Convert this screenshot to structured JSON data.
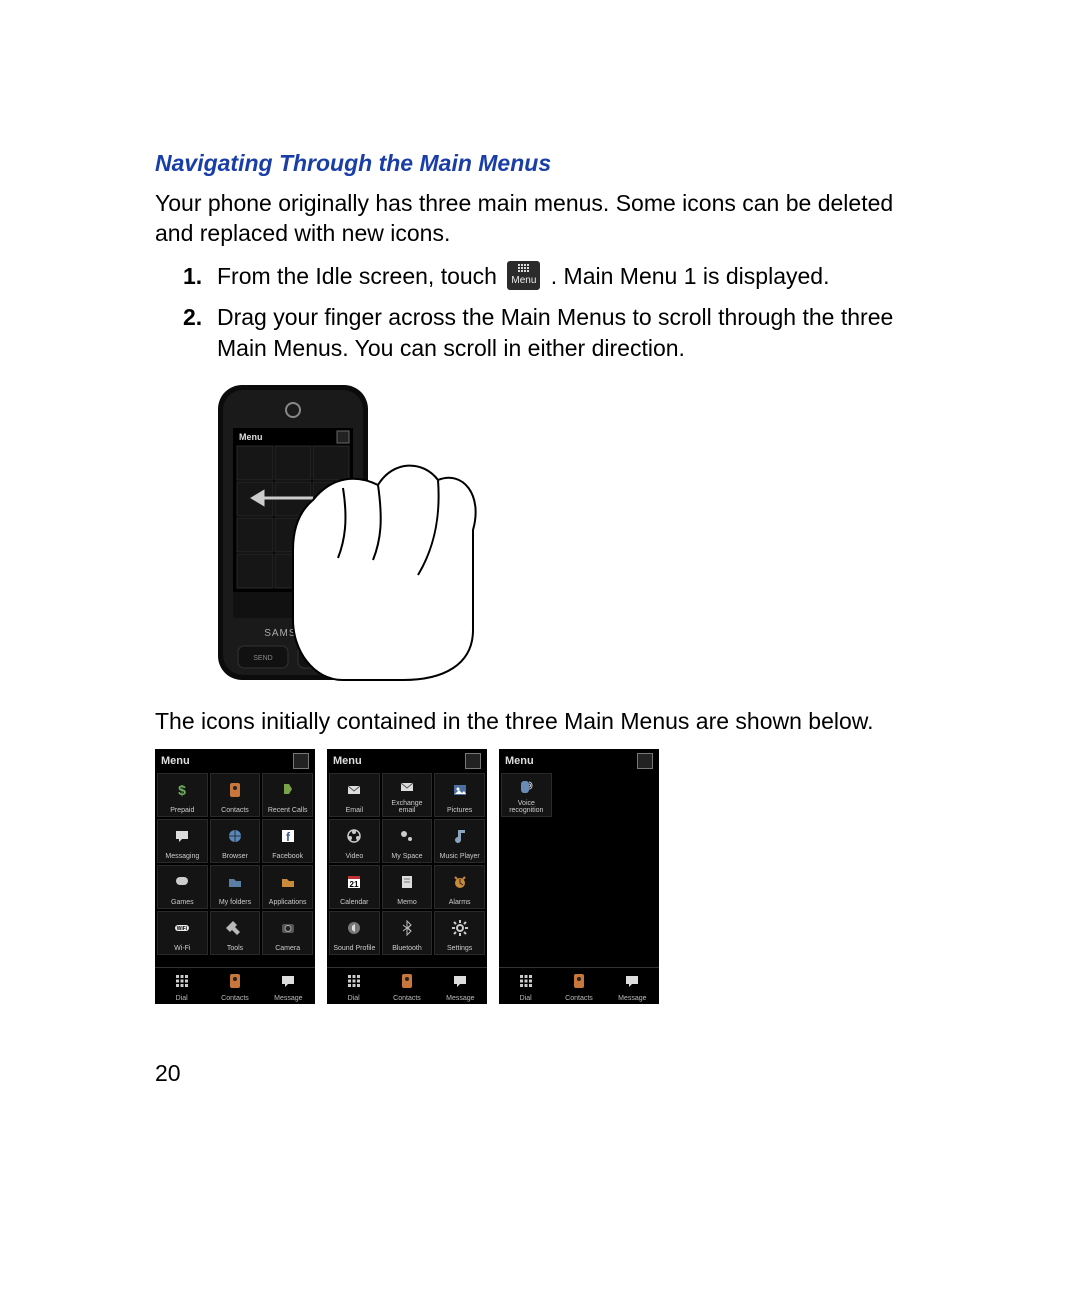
{
  "heading": "Navigating Through the Main Menus",
  "intro": "Your phone originally has three main menus. Some icons can be deleted and replaced with new icons.",
  "steps": {
    "s1_a": "From the Idle screen, touch",
    "s1_b": ". Main Menu 1 is displayed.",
    "chip": "Menu",
    "s2": "Drag your finger across the Main Menus to scroll through the three Main Menus. You can scroll in either direction."
  },
  "caption2": "The icons initially contained in the three Main Menus are shown below.",
  "page_number": "20",
  "menu_header": "Menu",
  "bottom_bar": [
    "Dial",
    "Contacts",
    "Message"
  ],
  "panels": [
    {
      "items": [
        "Prepaid",
        "Contacts",
        "Recent Calls",
        "Messaging",
        "Browser",
        "Facebook",
        "Games",
        "My folders",
        "Applications",
        "Wi-Fi",
        "Tools",
        "Camera"
      ]
    },
    {
      "items": [
        "Email",
        "Exchange email",
        "Pictures",
        "Video",
        "My Space",
        "Music Player",
        "Calendar",
        "Memo",
        "Alarms",
        "Sound Profile",
        "Bluetooth",
        "Settings"
      ]
    },
    {
      "items": [
        "Voice recognition"
      ]
    }
  ]
}
